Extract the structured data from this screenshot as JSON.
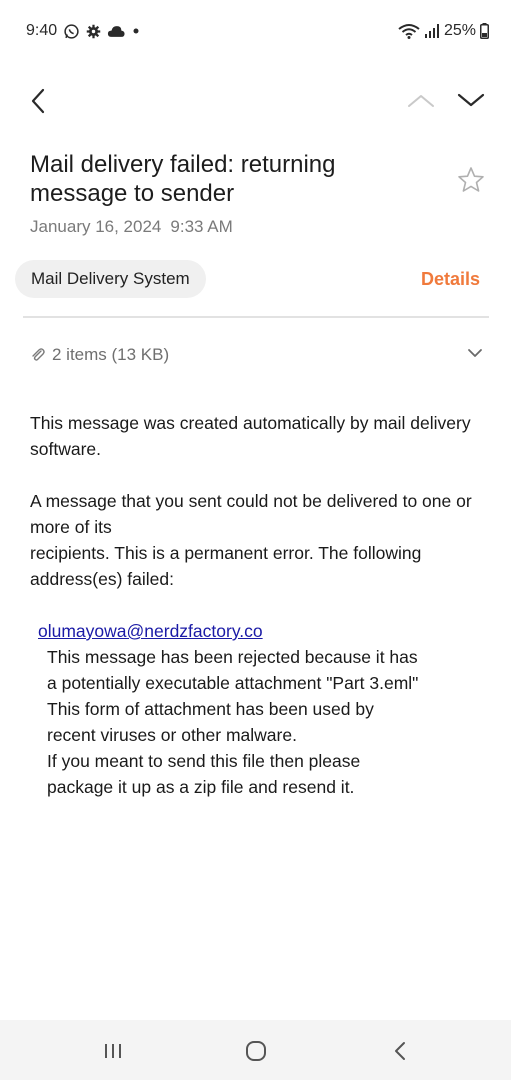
{
  "status_bar": {
    "time": "9:40",
    "battery": "25%",
    "icons": [
      "whatsapp-icon",
      "gear-icon",
      "cloud-icon",
      "dot-icon",
      "wifi-icon",
      "signal-icon",
      "battery-icon"
    ]
  },
  "toolbar": {
    "icons": [
      "back-arrow-icon",
      "chevron-up-icon",
      "chevron-down-icon"
    ]
  },
  "email": {
    "subject": "Mail delivery failed: returning message to sender",
    "date": "January 16, 2024",
    "time": "9:33 AM",
    "sender": "Mail Delivery System",
    "details_label": "Details",
    "attachments": "2 items (13 KB)",
    "body": {
      "p1": "This message was created automatically by mail delivery software.",
      "p2_line1": "A message that you sent could not be delivered to one or more of its",
      "p2_line2": "recipients. This is a permanent error. The following address(es) failed:",
      "failed_address": "olumayowa@nerdzfactory.co",
      "reason_lines": [
        "This message has been rejected because it has",
        "a potentially executable attachment \"Part 3.eml\"",
        "This form of attachment has been used by",
        "recent viruses or other malware.",
        "If you meant to send this file then please",
        "package it up as a zip file and resend it."
      ]
    }
  },
  "colors": {
    "accent": "#f07a3c",
    "link": "#1a1aa6",
    "muted": "#7a7a7a"
  },
  "nav_bar": {
    "icons": [
      "recent-apps-icon",
      "home-icon",
      "back-icon"
    ]
  }
}
